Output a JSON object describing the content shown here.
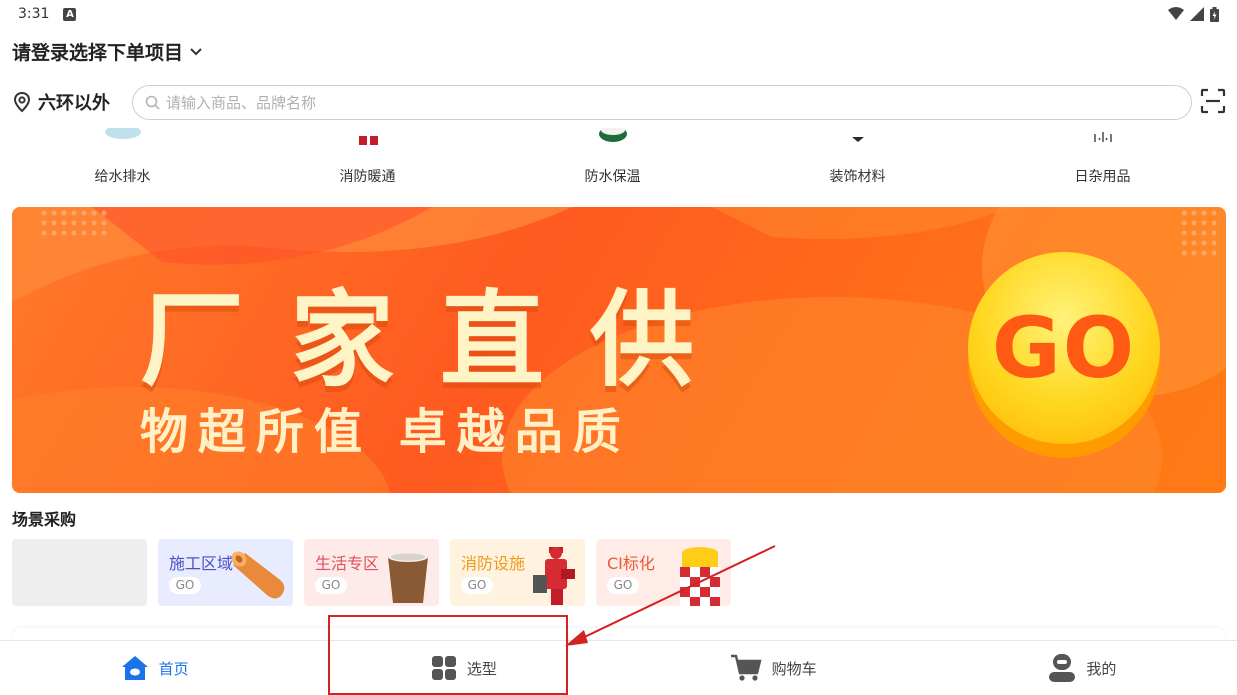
{
  "status_bar": {
    "time": "3:31",
    "notification_icon": "A"
  },
  "header": {
    "project_selector": "请登录选择下单项目",
    "location": "六环以外",
    "search_placeholder": "请输入商品、品牌名称"
  },
  "categories": [
    {
      "label": "给水排水",
      "icon": "water-pipe-icon"
    },
    {
      "label": "消防暖通",
      "icon": "fire-hvac-icon"
    },
    {
      "label": "防水保温",
      "icon": "waterproof-icon"
    },
    {
      "label": "装饰材料",
      "icon": "decoration-icon"
    },
    {
      "label": "日杂用品",
      "icon": "daily-goods-icon"
    }
  ],
  "banner": {
    "title": "厂家直供",
    "subtitle": "物超所值  卓越品质",
    "go_label": "GO",
    "colors": {
      "background": "#ff6a1f",
      "title": "#fff4c6",
      "go_circle": "#ffd61e"
    }
  },
  "scene_section": {
    "title": "场景采购",
    "items": [
      {
        "name": "",
        "go": ""
      },
      {
        "name": "施工区域",
        "go": "GO",
        "bg": "#e9ecff",
        "color": "#4a4fc8"
      },
      {
        "name": "生活专区",
        "go": "GO",
        "bg": "#ffeaea",
        "color": "#e0505a"
      },
      {
        "name": "消防设施",
        "go": "GO",
        "bg": "#fff3e0",
        "color": "#f09a1c"
      },
      {
        "name": "CI标化",
        "go": "GO",
        "bg": "#ffece6",
        "color": "#e85a3a"
      }
    ]
  },
  "tab_bar": {
    "tabs": [
      {
        "label": "首页",
        "icon": "home-icon",
        "active": true
      },
      {
        "label": "选型",
        "icon": "grid-icon",
        "active": false
      },
      {
        "label": "购物车",
        "icon": "cart-icon",
        "active": false
      },
      {
        "label": "我的",
        "icon": "profile-icon",
        "active": false
      }
    ],
    "active_color": "#1a73e8"
  }
}
